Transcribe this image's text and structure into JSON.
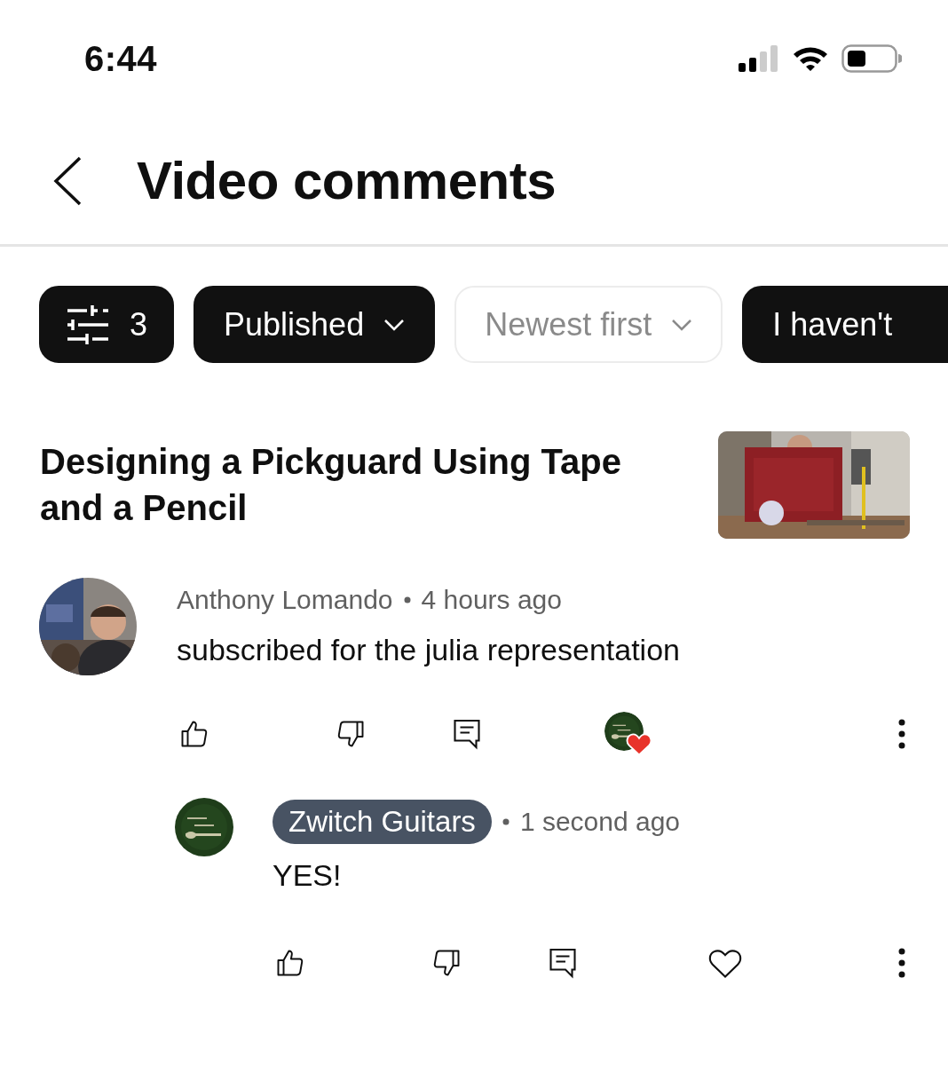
{
  "status_bar": {
    "time": "6:44"
  },
  "header": {
    "title": "Video comments"
  },
  "filters": [
    {
      "kind": "filter",
      "label": "3",
      "selected": true
    },
    {
      "kind": "dropdown",
      "label": "Published",
      "selected": true
    },
    {
      "kind": "dropdown",
      "label": "Newest first",
      "selected": false
    },
    {
      "kind": "chip",
      "label": "I haven't",
      "selected": true
    }
  ],
  "video": {
    "title": "Designing a Pickguard Using Tape and a Pencil"
  },
  "comments": [
    {
      "author": "Anthony Lomando",
      "is_owner": false,
      "time": "4 hours ago",
      "text": "subscribed for the julia representation",
      "hearted": true,
      "replies": [
        {
          "author": "Zwitch Guitars",
          "is_owner": true,
          "time": "1 second ago",
          "text": "YES!",
          "hearted": false
        }
      ]
    }
  ]
}
